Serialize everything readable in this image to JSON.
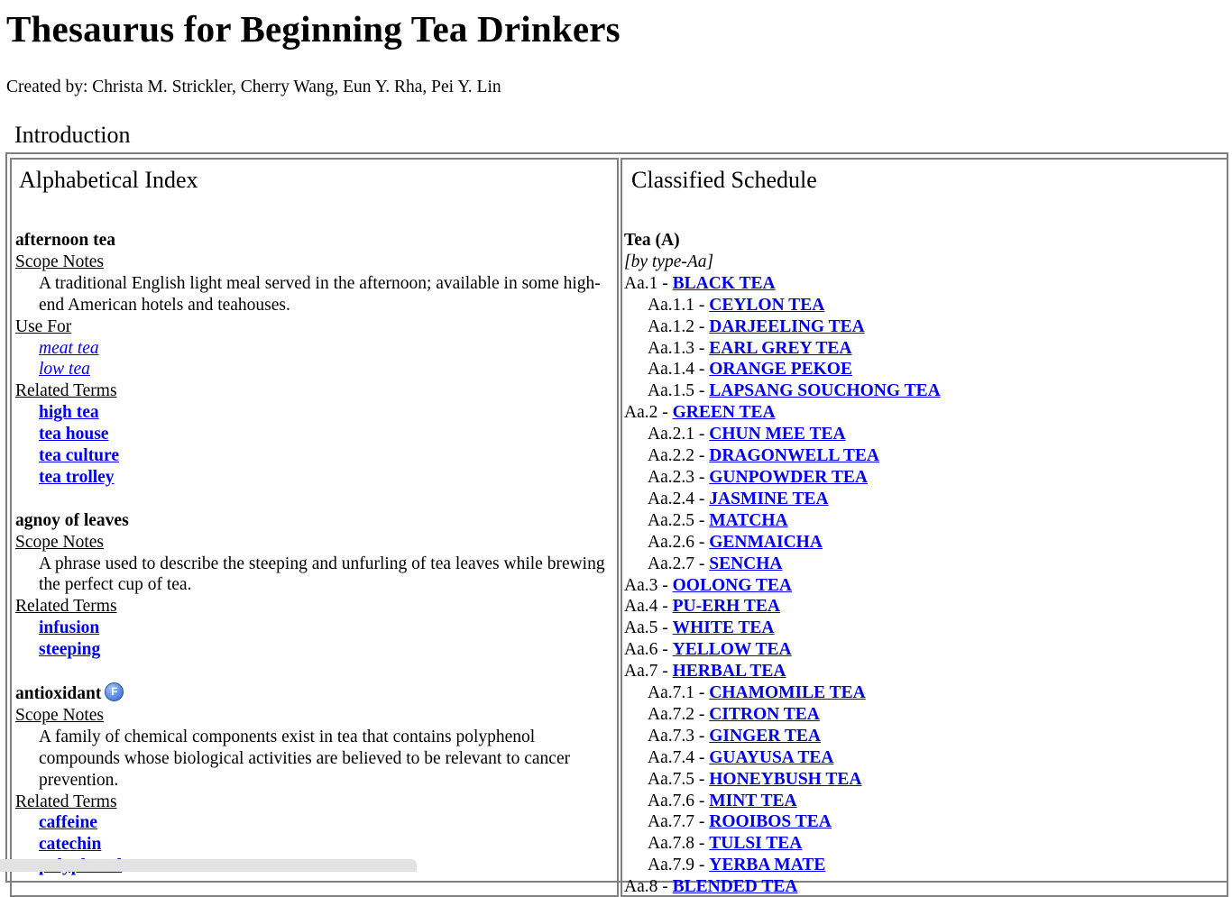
{
  "page": {
    "title": "Thesaurus for Beginning Tea Drinkers",
    "credit": "Created by: Christa M. Strickler, Cherry Wang, Eun Y. Rha, Pei Y. Lin",
    "intro_label": "Introduction"
  },
  "index": {
    "title": "Alphabetical Index",
    "scope_label": "Scope Notes",
    "use_for_label": "Use For",
    "related_label": "Related Terms",
    "entries": [
      {
        "term": "afternoon tea",
        "scope": "A traditional English light meal served in the afternoon; available in some high-end American hotels and teahouses.",
        "use_for": [
          "meat tea",
          "low tea"
        ],
        "related": [
          "high tea",
          "tea house",
          "tea culture",
          "tea trolley"
        ]
      },
      {
        "term": "agnoy of leaves",
        "scope": "A phrase used to describe the steeping and unfurling of tea leaves while brewing the perfect cup of tea.",
        "related": [
          "infusion",
          "steeping"
        ]
      },
      {
        "term": "antioxidant",
        "badge": "F",
        "scope": "A family of chemical components exist in tea that contains polyphenol compounds whose biological activities are believed to be relevant to cancer prevention.",
        "related": [
          "caffeine",
          "catechin",
          "polyphenol"
        ]
      }
    ]
  },
  "schedule": {
    "title": "Classified Schedule",
    "heading": "Tea (A)",
    "facet": "[by type-Aa]",
    "items": [
      {
        "code": "Aa.1 - ",
        "label": "BLACK TEA",
        "level": 1
      },
      {
        "code": "Aa.1.1 - ",
        "label": "CEYLON TEA",
        "level": 2
      },
      {
        "code": "Aa.1.2 - ",
        "label": "DARJEELING TEA",
        "level": 2
      },
      {
        "code": "Aa.1.3 - ",
        "label": "EARL GREY TEA",
        "level": 2
      },
      {
        "code": "Aa.1.4 - ",
        "label": "ORANGE PEKOE",
        "level": 2
      },
      {
        "code": "Aa.1.5 - ",
        "label": "LAPSANG SOUCHONG TEA",
        "level": 2
      },
      {
        "code": "Aa.2 - ",
        "label": "GREEN TEA",
        "level": 1
      },
      {
        "code": "Aa.2.1 - ",
        "label": "CHUN MEE TEA",
        "level": 2
      },
      {
        "code": "Aa.2.2 - ",
        "label": "DRAGONWELL TEA",
        "level": 2
      },
      {
        "code": "Aa.2.3 - ",
        "label": "GUNPOWDER TEA",
        "level": 2
      },
      {
        "code": "Aa.2.4 - ",
        "label": "JASMINE TEA",
        "level": 2
      },
      {
        "code": "Aa.2.5 - ",
        "label": "MATCHA",
        "level": 2
      },
      {
        "code": "Aa.2.6 - ",
        "label": "GENMAICHA",
        "level": 2
      },
      {
        "code": "Aa.2.7 - ",
        "label": "SENCHA",
        "level": 2
      },
      {
        "code": "Aa.3 - ",
        "label": "OOLONG TEA",
        "level": 1
      },
      {
        "code": "Aa.4 - ",
        "label": "PU-ERH TEA",
        "level": 1
      },
      {
        "code": "Aa.5 - ",
        "label": "WHITE TEA",
        "level": 1
      },
      {
        "code": "Aa.6 - ",
        "label": "YELLOW TEA",
        "level": 1
      },
      {
        "code": "Aa.7 - ",
        "label": "HERBAL TEA",
        "level": 1
      },
      {
        "code": "Aa.7.1 - ",
        "label": "CHAMOMILE TEA",
        "level": 2
      },
      {
        "code": "Aa.7.2 - ",
        "label": "CITRON TEA",
        "level": 2
      },
      {
        "code": "Aa.7.3 - ",
        "label": "GINGER TEA",
        "level": 2
      },
      {
        "code": "Aa.7.4 - ",
        "label": "GUAYUSA TEA",
        "level": 2
      },
      {
        "code": "Aa.7.5 - ",
        "label": "HONEYBUSH TEA",
        "level": 2
      },
      {
        "code": "Aa.7.6 - ",
        "label": "MINT TEA",
        "level": 2
      },
      {
        "code": "Aa.7.7 - ",
        "label": "ROOIBOS TEA",
        "level": 2
      },
      {
        "code": "Aa.7.8 - ",
        "label": "TULSI TEA",
        "level": 2
      },
      {
        "code": "Aa.7.9 - ",
        "label": "YERBA MATE",
        "level": 2
      },
      {
        "code": "Aa.8 - ",
        "label": "BLENDED TEA",
        "level": 1
      }
    ]
  },
  "colors": {
    "link": "#0000ee",
    "border": "#7f7f7f"
  },
  "icons": {
    "badge": "facet-f-badge-icon"
  }
}
